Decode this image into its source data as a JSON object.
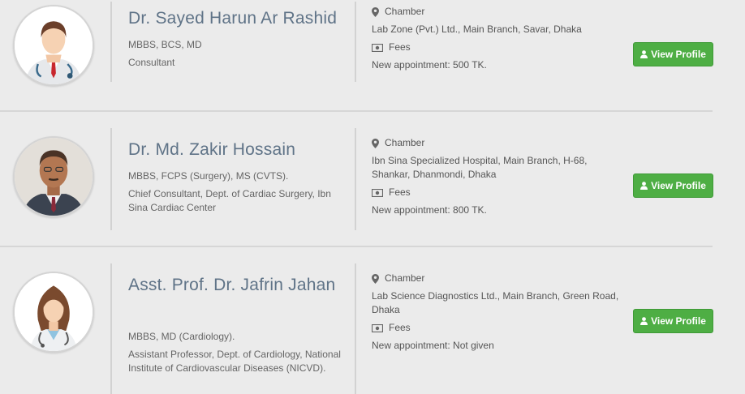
{
  "doctors": [
    {
      "name": "Dr. Sayed Harun Ar Rashid",
      "degree": "MBBS, BCS, MD",
      "designation": "Consultant",
      "chamber_label": "Chamber",
      "chamber": "Lab Zone (Pvt.) Ltd., Main Branch, Savar, Dhaka",
      "fees_label": "Fees",
      "fee": "New appointment: 500 TK.",
      "button": "View Profile",
      "avatar": "male-doctor-illustration"
    },
    {
      "name": "Dr. Md. Zakir Hossain",
      "degree": "MBBS, FCPS (Surgery), MS (CVTS).",
      "designation": "Chief Consultant, Dept. of Cardiac Surgery, Ibn Sina Cardiac Center",
      "chamber_label": "Chamber",
      "chamber": "Ibn Sina Specialized Hospital, Main Branch, H-68, Shankar, Dhanmondi, Dhaka",
      "fees_label": "Fees",
      "fee": "New appointment: 800 TK.",
      "button": "View Profile",
      "avatar": "doctor-photo"
    },
    {
      "name": "Asst. Prof. Dr. Jafrin Jahan",
      "degree": "MBBS, MD (Cardiology).",
      "designation": "Assistant Professor, Dept. of Cardiology, National Institute of Cardiovascular Diseases (NICVD).",
      "chamber_label": "Chamber",
      "chamber": "Lab Science Diagnostics Ltd., Main Branch, Green Road, Dhaka",
      "fees_label": "Fees",
      "fee": "New appointment: Not given",
      "button": "View Profile",
      "avatar": "female-doctor-illustration"
    }
  ],
  "colors": {
    "button_green": "#4eae44",
    "name_color": "#5f7387",
    "background": "#ebebeb"
  }
}
